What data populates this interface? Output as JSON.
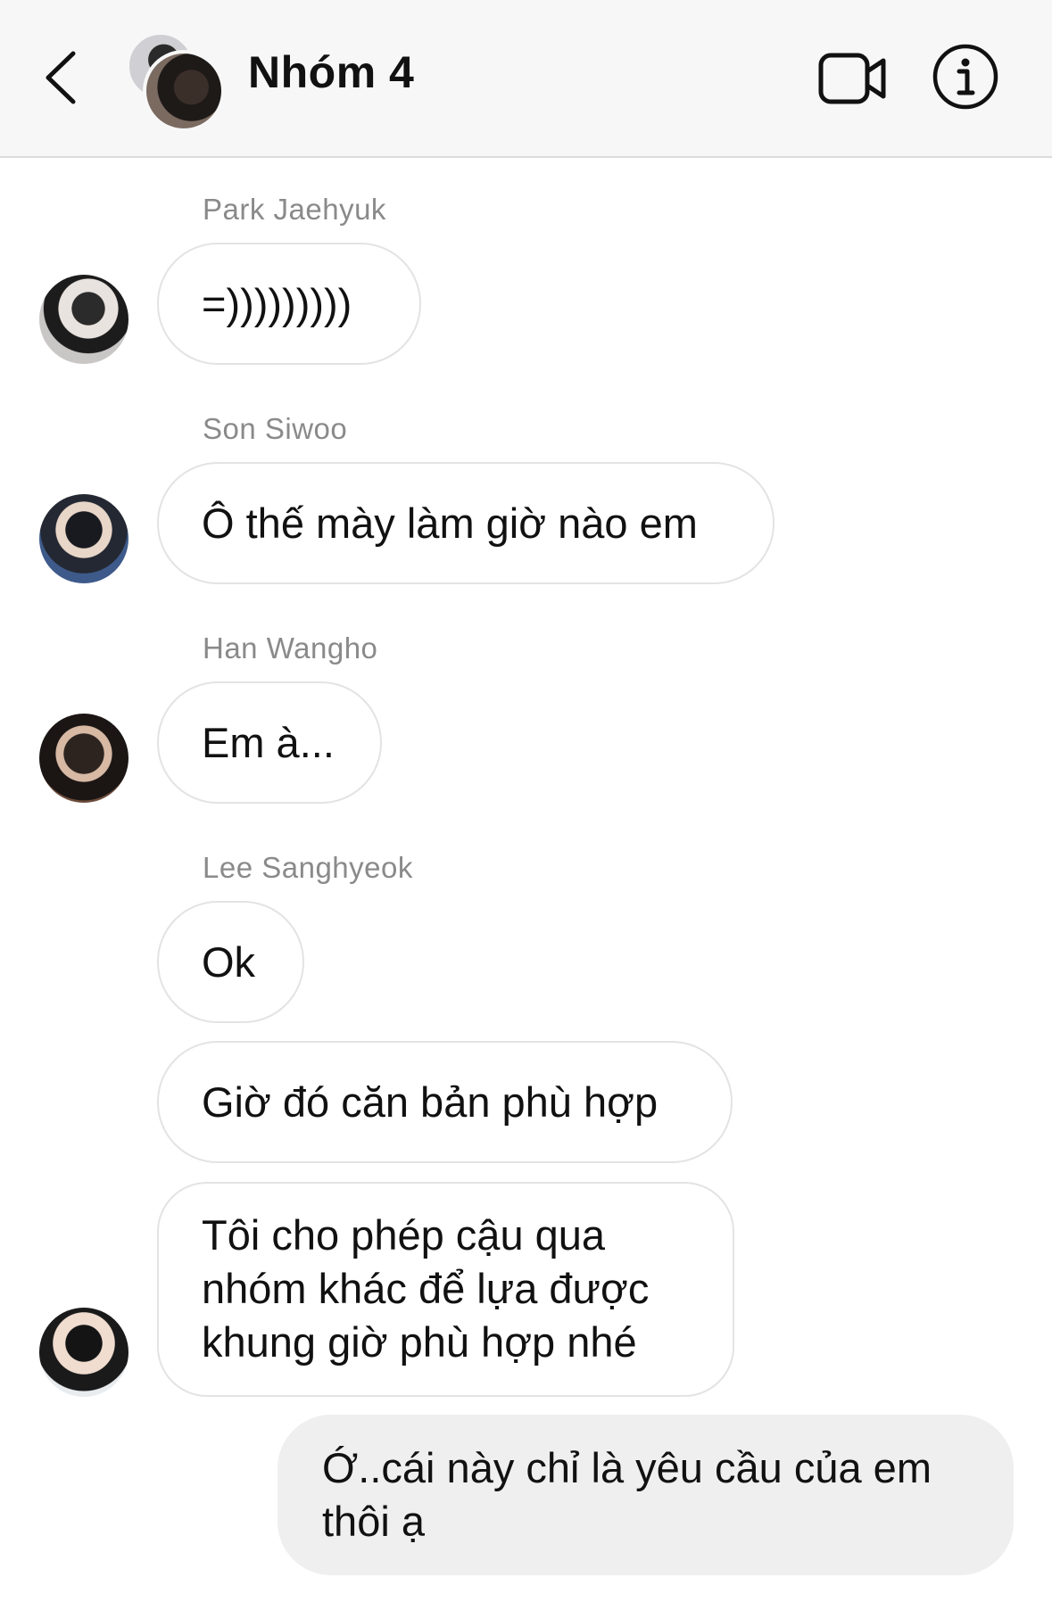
{
  "header": {
    "title": "Nhóm 4",
    "back_icon": "chevron-left-icon",
    "video_icon": "video-camera-icon",
    "info_icon": "info-icon"
  },
  "messages": [
    {
      "sender": "Park Jaehyuk",
      "texts": [
        "=)))))))))"
      ]
    },
    {
      "sender": "Son Siwoo",
      "texts": [
        "Ô thế mày làm giờ nào em"
      ]
    },
    {
      "sender": "Han Wangho",
      "texts": [
        "Em à..."
      ]
    },
    {
      "sender": "Lee Sanghyeok",
      "texts": [
        "Ok",
        "Giờ đó căn bản phù hợp",
        "Tôi cho phép cậu qua nhóm khác để lựa được khung giờ phù hợp nhé"
      ]
    }
  ],
  "my_message": "Ớ..cái này chỉ là yêu cầu của em thôi ạ",
  "colors": {
    "header_bg": "#f7f7f7",
    "bubble_border": "#e3e3e3",
    "my_bubble_bg": "#efefef",
    "sender_text": "#8a8a8a"
  }
}
